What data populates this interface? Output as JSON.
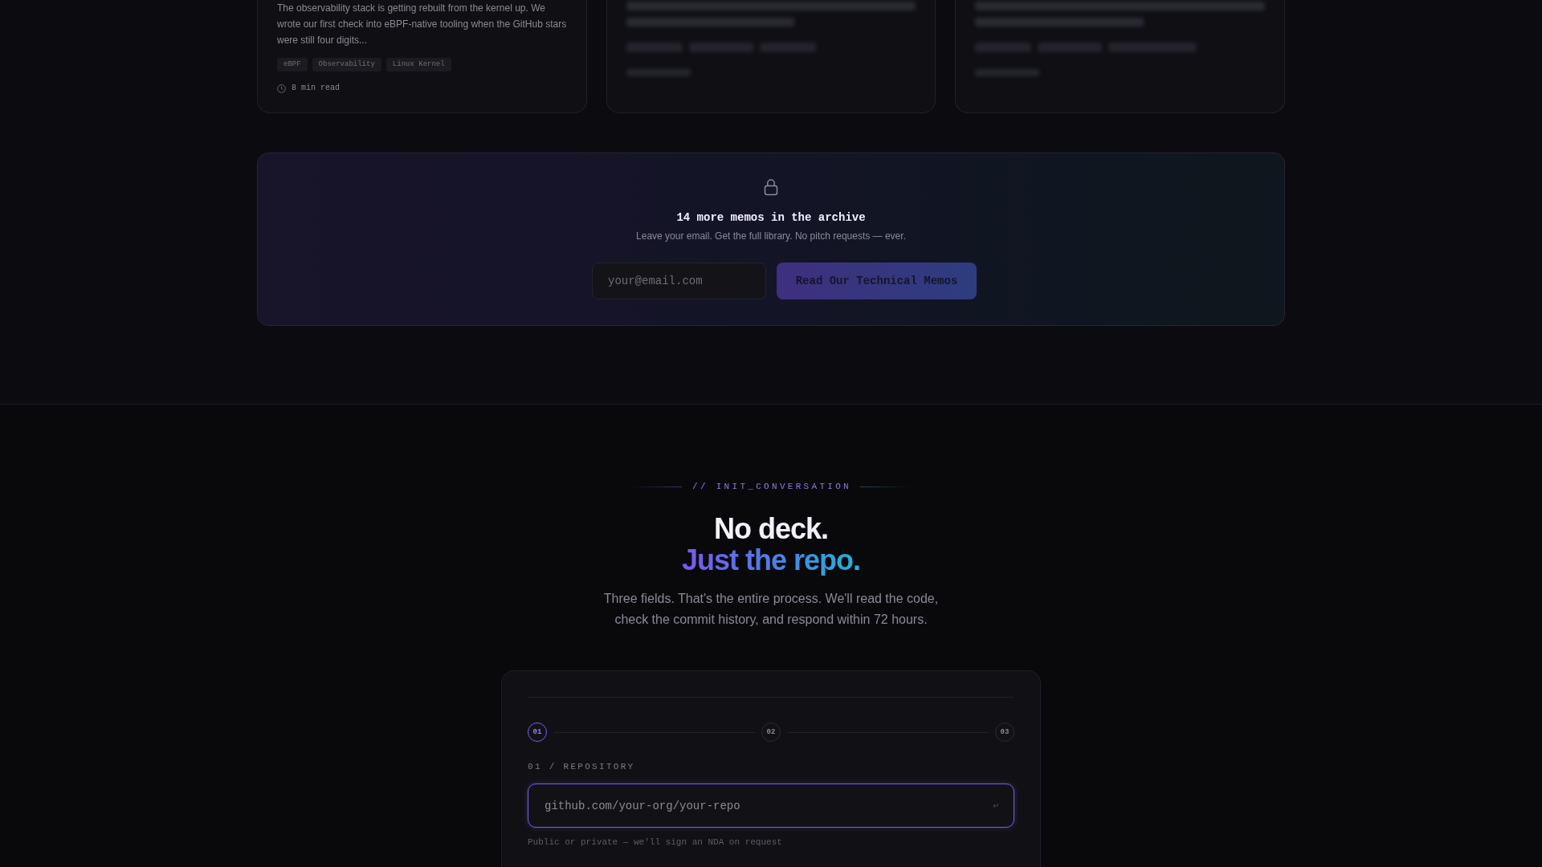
{
  "articles": [
    {
      "kind": "open",
      "excerpt": "The observability stack is getting rebuilt from the kernel up. We wrote our first check into eBPF-native tooling when the GitHub stars were still four digits...",
      "tags": [
        "eBPF",
        "Observability",
        "Linux Kernel"
      ],
      "read_time": "8 min read"
    },
    {
      "kind": "blurred"
    },
    {
      "kind": "blurred"
    }
  ],
  "archive": {
    "title": "14 more memos in the archive",
    "subtitle": "Leave your email. Get the full library. No pitch requests — ever.",
    "email": {
      "placeholder": "your@email.com"
    },
    "button": "Read Our Technical Memos"
  },
  "contact": {
    "eyebrow": "// INIT_CONVERSATION",
    "heading": "No deck.",
    "heading_accent": "Just the repo.",
    "intro": "Three fields. That's the entire process. We'll read the code, check the commit history, and respond within 72 hours.",
    "form": {
      "steps": [
        {
          "label": "01",
          "selected": true
        },
        {
          "label": "02",
          "selected": false
        },
        {
          "label": "03",
          "selected": false
        }
      ],
      "field_label": "01 / REPOSITORY",
      "repo_field": {
        "placeholder": "github.com/your-org/your-repo",
        "focused": true
      },
      "submit_hint": "↵",
      "hint": "Public or private — we'll sign an NDA on request"
    }
  }
}
